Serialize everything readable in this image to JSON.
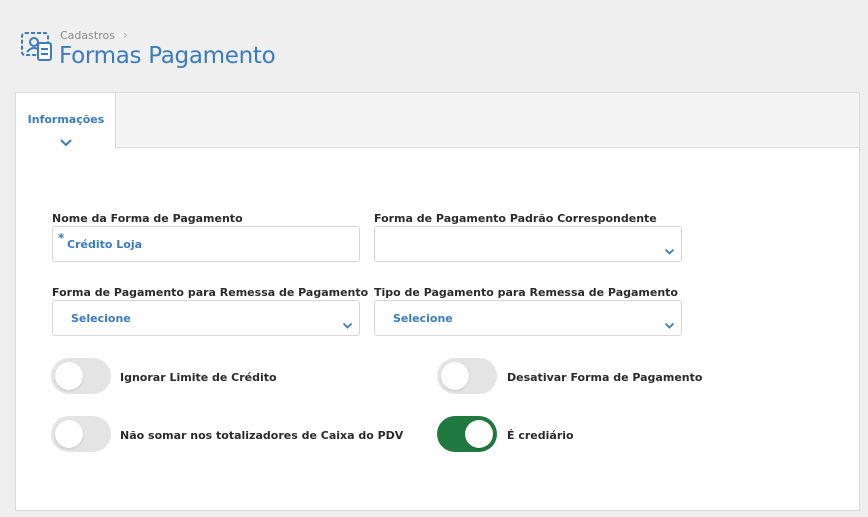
{
  "breadcrumb": {
    "parent": "Cadastros",
    "separator": "›"
  },
  "page": {
    "title": "Formas Pagamento"
  },
  "tabs": [
    {
      "label": "Informações",
      "active": true
    }
  ],
  "form": {
    "nome": {
      "label": "Nome da Forma de Pagamento",
      "value": "Crédito Loja",
      "required_mark": "*"
    },
    "padrao": {
      "label": "Forma de Pagamento Padrão Correspondente",
      "value": ""
    },
    "remessa_forma": {
      "label": "Forma de Pagamento para Remessa de Pagamento",
      "value": "Selecione"
    },
    "remessa_tipo": {
      "label": "Tipo de Pagamento para Remessa de Pagamento",
      "value": "Selecione"
    }
  },
  "toggles": {
    "ignorar_limite": {
      "label": "Ignorar Limite de Crédito",
      "on": false
    },
    "desativar": {
      "label": "Desativar Forma de Pagamento",
      "on": false
    },
    "nao_somar": {
      "label": "Não somar nos totalizadores de Caixa do PDV",
      "on": false
    },
    "crediario": {
      "label": "É crediário",
      "on": true
    }
  },
  "colors": {
    "accent": "#3b7bbf",
    "toggle_on": "#1e7a3e",
    "toggle_off": "#e4e4e4"
  },
  "icons": {
    "header": "contacts-card-icon",
    "chevron": "chevron-down-icon"
  }
}
